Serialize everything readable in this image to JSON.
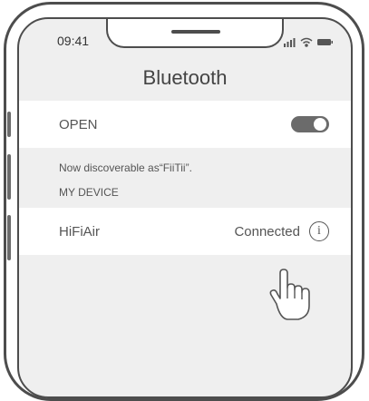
{
  "status_bar": {
    "time": "09:41"
  },
  "header": {
    "title": "Bluetooth"
  },
  "open_row": {
    "label": "OPEN",
    "toggle_on": true
  },
  "discoverable_text": "Now discoverable as“FiiTii”.",
  "section_label": "MY DEVICE",
  "device": {
    "name": "HiFiAir",
    "status": "Connected",
    "info_icon": "i"
  },
  "icons": [
    "signal-icon",
    "wifi-icon",
    "battery-icon",
    "info-icon",
    "pointer-hand-icon"
  ]
}
